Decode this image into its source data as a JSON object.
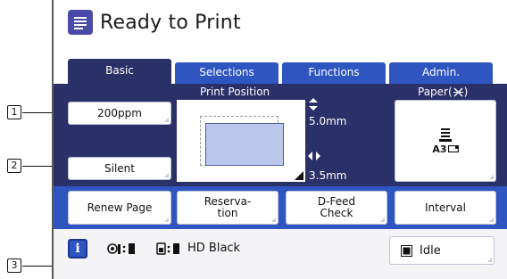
{
  "title": "Ready to Print",
  "tabs": [
    {
      "label": "Basic",
      "active": true
    },
    {
      "label": "Selections",
      "active": false
    },
    {
      "label": "Functions",
      "active": false
    },
    {
      "label": "Admin.",
      "active": false
    }
  ],
  "speed_button": "200ppm",
  "silent_button": "Silent",
  "print_position": {
    "label": "Print Position",
    "vertical_offset": "5.0mm",
    "horizontal_offset": "3.5mm"
  },
  "paper": {
    "label": "Paper(",
    "label_close": ")",
    "size": "A3"
  },
  "action_buttons": [
    {
      "line1": "Renew Page",
      "line2": ""
    },
    {
      "line1": "Reserva-",
      "line2": "tion"
    },
    {
      "line1": "D-Feed",
      "line2": "Check"
    },
    {
      "line1": "Interval",
      "line2": ""
    }
  ],
  "status_bar": {
    "ink_label": "HD Black",
    "idle_label": "Idle"
  },
  "callouts": [
    "1",
    "2",
    "3"
  ],
  "colors": {
    "dark_panel": "#2a3068",
    "blue_panel": "#2f55c0",
    "title_icon": "#4a4aa8"
  },
  "icons": [
    "document-list-icon",
    "up-down-arrow-icon",
    "left-right-arrow-icon",
    "paper-tray-icon",
    "info-icon",
    "master-icon",
    "ink-icon",
    "idle-indicator-icon"
  ]
}
